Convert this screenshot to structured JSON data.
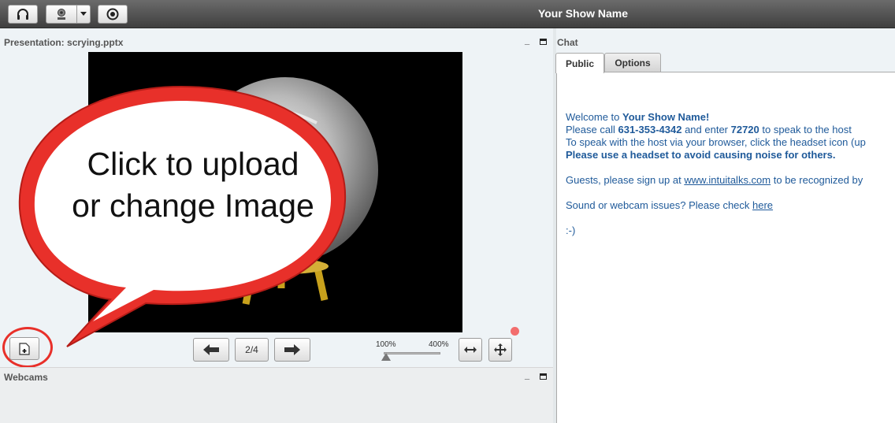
{
  "header": {
    "show_name": "Your Show Name"
  },
  "presentation": {
    "title": "Presentation: scrying.pptx",
    "page_indicator": "2/4",
    "zoom_min": "100%",
    "zoom_max": "400%",
    "zoom_level_percent": 100,
    "callout_line1": "Click to upload",
    "callout_line2": "or change Image"
  },
  "webcams": {
    "title": "Webcams"
  },
  "chat": {
    "title": "Chat",
    "tabs": [
      {
        "label": "Public",
        "active": true
      },
      {
        "label": "Options",
        "active": false
      }
    ],
    "welcome_prefix": "Welcome to ",
    "welcome_name": "Your Show Name!",
    "call_prefix": " Please call ",
    "call_number": "631-353-4342",
    "call_mid": " and enter ",
    "call_code": "72720",
    "call_suffix": " to speak to the host",
    "browser_line": "To speak with the host via your browser, click the headset icon (up",
    "headset_line": "Please use a headset to avoid causing noise for others.",
    "guests_prefix": "Guests, please sign up at ",
    "guests_link": "www.intuitalks.com",
    "guests_suffix": " to be recognized by",
    "sound_prefix": "Sound or webcam issues? Please check ",
    "sound_link": "here",
    "smiley": ":-)"
  },
  "colors": {
    "chat_text": "#1f5a9a",
    "callout_red": "#e8302a",
    "record_dot": "#f26d6d"
  },
  "icons": [
    "headset-icon",
    "webcam-icon",
    "dropdown-arrow-icon",
    "record-icon",
    "arrow-left-icon",
    "arrow-right-icon",
    "fit-width-icon",
    "move-icon",
    "upload-file-icon",
    "minimize-icon",
    "maximize-icon"
  ]
}
